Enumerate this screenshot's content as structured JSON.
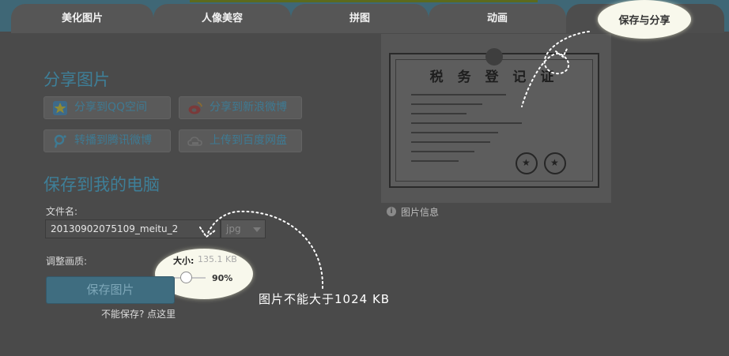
{
  "tabs": [
    {
      "label": "美化图片"
    },
    {
      "label": "人像美容"
    },
    {
      "label": "拼图"
    },
    {
      "label": "动画"
    },
    {
      "label": "保存与分享"
    }
  ],
  "share": {
    "title": "分享图片",
    "buttons": [
      {
        "label": "分享到QQ空间",
        "icon": "qzone-star-icon"
      },
      {
        "label": "分享到新浪微博",
        "icon": "weibo-icon"
      },
      {
        "label": "转播到腾讯微博",
        "icon": "tencent-weibo-icon"
      },
      {
        "label": "上传到百度网盘",
        "icon": "baidu-cloud-icon"
      }
    ]
  },
  "save": {
    "title": "保存到我的电脑",
    "filename_label": "文件名:",
    "filename_value": "20130902075109_meitu_2",
    "format_value": "jpg",
    "quality_label": "调整画质:",
    "size_label": "大小:",
    "size_value": "135.1 KB",
    "quality_percent": "90%",
    "quality_fraction": 0.9,
    "save_button": "保存图片",
    "cant_save_link": "不能保存? 点这里"
  },
  "preview": {
    "certificate_title": "税 务 登 记 证",
    "info_label": "图片信息"
  },
  "annotation": {
    "note": "图片不能大于1024 KB"
  },
  "colors": {
    "accent": "#3e7f98",
    "highlight": "#f8f8ec",
    "overlay": "#4a4a4a"
  }
}
